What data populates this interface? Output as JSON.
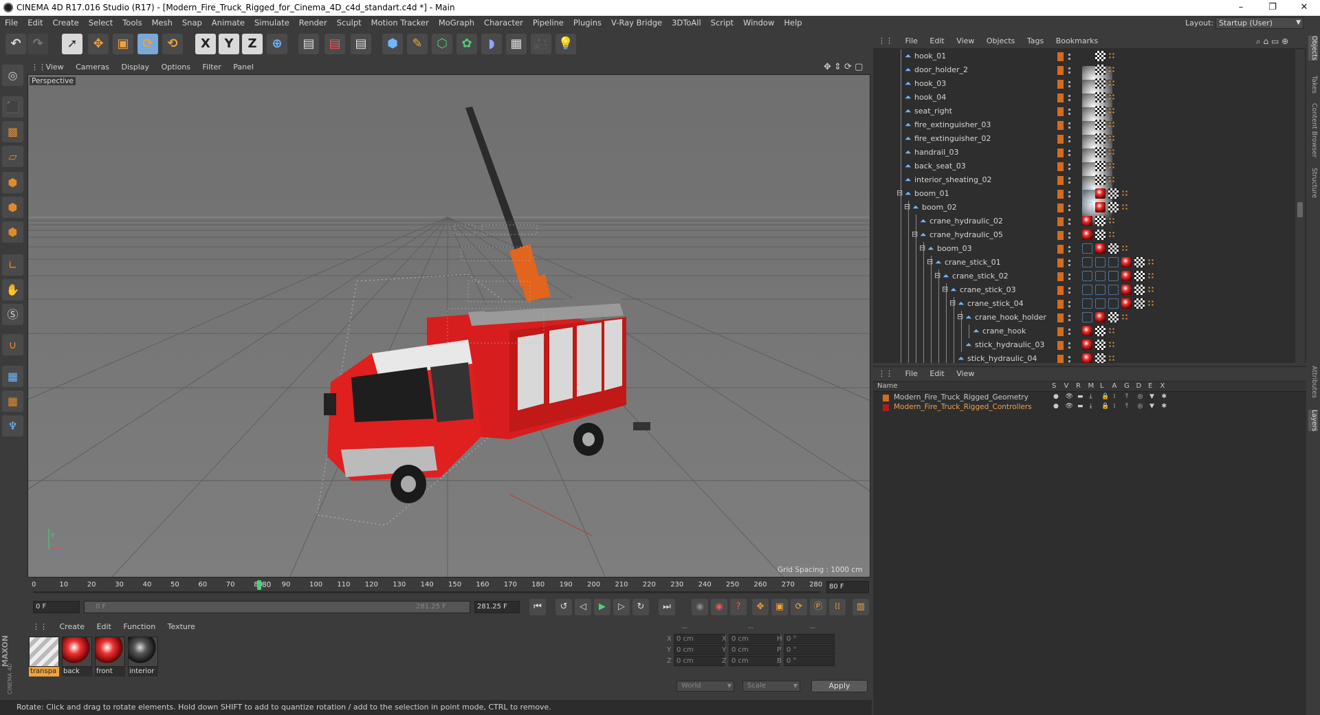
{
  "titlebar": {
    "title": "CINEMA 4D R17.016 Studio (R17) - [Modern_Fire_Truck_Rigged_for_Cinema_4D_c4d_standart.c4d *] - Main",
    "minimize": "–",
    "restore": "❐",
    "close": "✕"
  },
  "menubar": [
    "File",
    "Edit",
    "Create",
    "Select",
    "Tools",
    "Mesh",
    "Snap",
    "Animate",
    "Simulate",
    "Render",
    "Sculpt",
    "Motion Tracker",
    "MoGraph",
    "Character",
    "Pipeline",
    "Plugins",
    "V-Ray Bridge",
    "3DToAll",
    "Script",
    "Window",
    "Help"
  ],
  "layout": {
    "label": "Layout:",
    "value": "Startup (User)"
  },
  "viewport": {
    "menu": [
      "View",
      "Cameras",
      "Display",
      "Options",
      "Filter",
      "Panel"
    ],
    "camera_label": "Perspective",
    "grid_spacing": "Grid Spacing : 1000 cm",
    "axis": {
      "y": "Y",
      "z": "Z"
    }
  },
  "timeline": {
    "ticks": [
      "0",
      "10",
      "20",
      "30",
      "40",
      "50",
      "60",
      "70",
      "80",
      "90",
      "100",
      "110",
      "120",
      "130",
      "140",
      "150",
      "160",
      "170",
      "180",
      "190",
      "200",
      "210",
      "220",
      "230",
      "240",
      "250",
      "260",
      "270",
      "280"
    ],
    "current_frame": "80",
    "end_field": "80 F"
  },
  "transport": {
    "start_field": "0 F",
    "range_start": "0 F",
    "range_end": "281.25 F",
    "end_field": "281.25 F"
  },
  "materials": {
    "menu": [
      "Create",
      "Edit",
      "Function",
      "Texture"
    ],
    "items": [
      {
        "name": "transpa",
        "kind": "stripe"
      },
      {
        "name": "back",
        "kind": "red"
      },
      {
        "name": "front",
        "kind": "red"
      },
      {
        "name": "interior",
        "kind": "dark"
      }
    ]
  },
  "coords": {
    "headers": [
      "--",
      "--",
      "--"
    ],
    "rows": [
      {
        "a": "X",
        "av": "0 cm",
        "b": "X",
        "bv": "0 cm",
        "c": "H",
        "cv": "0 °"
      },
      {
        "a": "Y",
        "av": "0 cm",
        "b": "Y",
        "bv": "0 cm",
        "c": "P",
        "cv": "0 °"
      },
      {
        "a": "Z",
        "av": "0 cm",
        "b": "Z",
        "bv": "0 cm",
        "c": "B",
        "cv": "0 °"
      }
    ],
    "world": "World",
    "scale": "Scale",
    "apply": "Apply"
  },
  "status": "Rotate: Click and drag to rotate elements. Hold down SHIFT to add to quantize rotation / add to the selection in point mode, CTRL to remove.",
  "maxon": {
    "brand": "MAXON",
    "product": "CINEMA 4D"
  },
  "objects": {
    "menu": [
      "File",
      "Edit",
      "View",
      "Objects",
      "Tags",
      "Bookmarks"
    ],
    "rows": [
      {
        "name": "hook_01",
        "depth": 0,
        "exp": "",
        "tags": "mat"
      },
      {
        "name": "door_holder_2",
        "depth": 0,
        "exp": "",
        "tags": "mat"
      },
      {
        "name": "hook_03",
        "depth": 0,
        "exp": "",
        "tags": "mat"
      },
      {
        "name": "hook_04",
        "depth": 0,
        "exp": "",
        "tags": "mat"
      },
      {
        "name": "seat_right",
        "depth": 0,
        "exp": "",
        "tags": "mat"
      },
      {
        "name": "fire_extinguisher_03",
        "depth": 0,
        "exp": "",
        "tags": "mat"
      },
      {
        "name": "fire_extinguisher_02",
        "depth": 0,
        "exp": "",
        "tags": "mat"
      },
      {
        "name": "handrail_03",
        "depth": 0,
        "exp": "",
        "tags": "mat"
      },
      {
        "name": "back_seat_03",
        "depth": 0,
        "exp": "",
        "tags": "mat"
      },
      {
        "name": "interior_sheating_02",
        "depth": 0,
        "exp": "",
        "tags": "mat"
      },
      {
        "name": "boom_01",
        "depth": 0,
        "exp": "⊟",
        "tags": "rig1"
      },
      {
        "name": "boom_02",
        "depth": 1,
        "exp": "⊟",
        "tags": "rig1"
      },
      {
        "name": "crane_hydraulic_02",
        "depth": 2,
        "exp": "",
        "tags": "red"
      },
      {
        "name": "crane_hydraulic_05",
        "depth": 2,
        "exp": "⊟",
        "tags": "red"
      },
      {
        "name": "boom_03",
        "depth": 3,
        "exp": "⊟",
        "tags": "rig1"
      },
      {
        "name": "crane_stick_01",
        "depth": 4,
        "exp": "⊟",
        "tags": "rig2"
      },
      {
        "name": "crane_stick_02",
        "depth": 5,
        "exp": "⊟",
        "tags": "rig2"
      },
      {
        "name": "crane_stick_03",
        "depth": 6,
        "exp": "⊟",
        "tags": "rig2"
      },
      {
        "name": "crane_stick_04",
        "depth": 7,
        "exp": "⊟",
        "tags": "rig2"
      },
      {
        "name": "crane_hook_holder",
        "depth": 8,
        "exp": "⊟",
        "tags": "rig1"
      },
      {
        "name": "crane_hook",
        "depth": 9,
        "exp": "",
        "tags": "red"
      },
      {
        "name": "stick_hydraulic_03",
        "depth": 8,
        "exp": "",
        "tags": "red"
      },
      {
        "name": "stick_hydraulic_04",
        "depth": 7,
        "exp": "",
        "tags": "red"
      }
    ]
  },
  "layers": {
    "menu": [
      "File",
      "Edit",
      "View"
    ],
    "columns": {
      "name": "Name",
      "flags": [
        "S",
        "V",
        "R",
        "M",
        "L",
        "A",
        "G",
        "D",
        "E",
        "X"
      ]
    },
    "rows": [
      {
        "name": "Modern_Fire_Truck_Rigged_Geometry",
        "color": "#d46b1f",
        "text_color": "#c9c9c9"
      },
      {
        "name": "Modern_Fire_Truck_Rigged_Controllers",
        "color": "#b01c1c",
        "text_color": "#f0a050"
      }
    ]
  },
  "side_tabs": [
    "Objects",
    "Takes",
    "Content Browser",
    "Structure",
    "Attributes",
    "Layers"
  ]
}
